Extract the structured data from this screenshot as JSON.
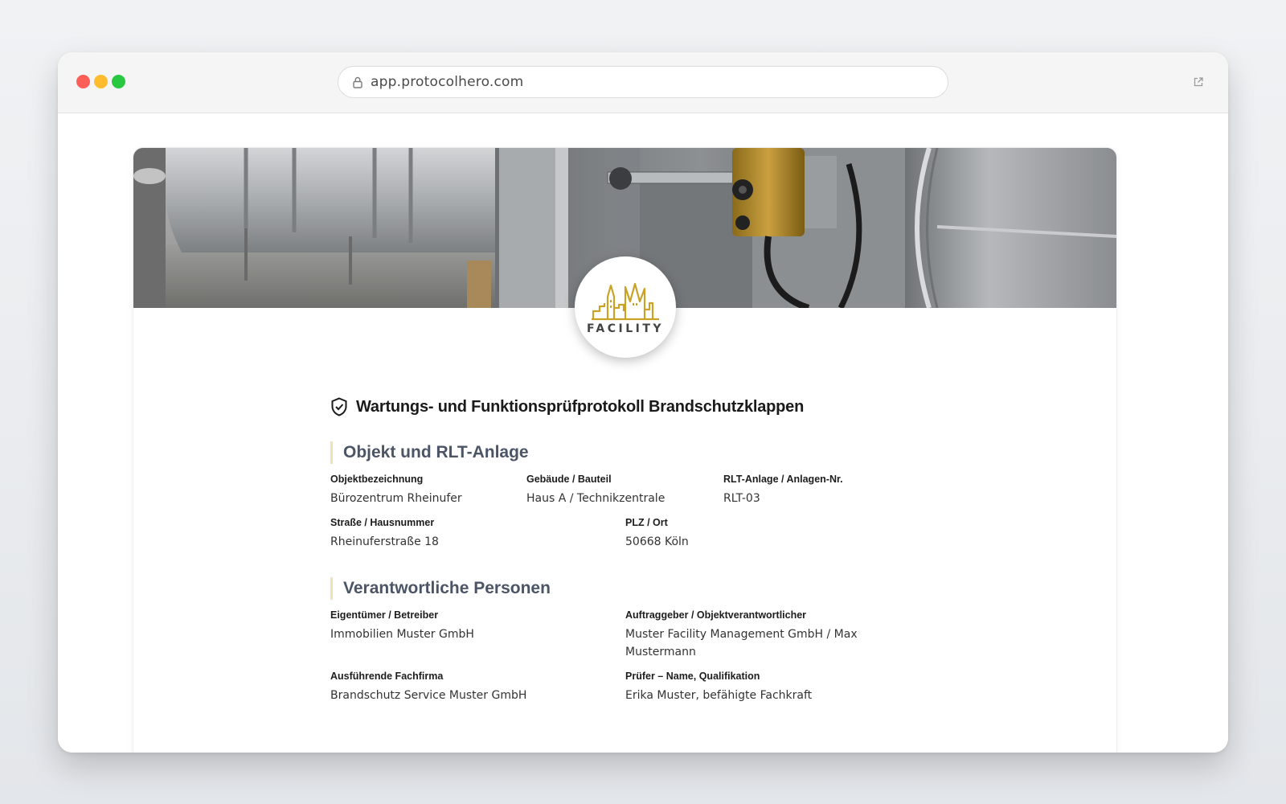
{
  "browser": {
    "url": "app.protocolhero.com",
    "icons": {
      "lock": "lock-icon",
      "external": "external-link-icon"
    }
  },
  "logo": {
    "text": "FACILITY",
    "accent": "#c9a227"
  },
  "document": {
    "title": "Wartungs- und Funktionsprüfprotokoll Brandschutzklappen",
    "title_icon": "shield-check-icon",
    "sections": [
      {
        "heading": "Objekt und RLT-Anlage",
        "fields": [
          {
            "label": "Objektbezeichnung",
            "value": "Bürozentrum Rheinufer"
          },
          {
            "label": "Gebäude / Bauteil",
            "value": "Haus A / Technikzentrale"
          },
          {
            "label": "RLT-Anlage / Anlagen-Nr.",
            "value": "RLT-03"
          },
          {
            "label": "Straße / Hausnummer",
            "value": "Rheinuferstraße 18"
          },
          {
            "label": "PLZ / Ort",
            "value": "50668 Köln"
          }
        ]
      },
      {
        "heading": "Verantwortliche Personen",
        "fields": [
          {
            "label": "Eigentümer / Betreiber",
            "value": "Immobilien Muster GmbH"
          },
          {
            "label": "Auftraggeber / Objektverantwortlicher",
            "value": "Muster Facility Management GmbH / Max Mustermann"
          },
          {
            "label": "Ausführende Fachfirma",
            "value": "Brandschutz Service Muster GmbH"
          },
          {
            "label": "Prüfer – Name, Qualifikation",
            "value": "Erika Muster, befähigte Fachkraft"
          }
        ]
      }
    ]
  },
  "colors": {
    "section_accent": "#f1e2b3",
    "section_heading": "#4c5566",
    "traffic_red": "#fe5f57",
    "traffic_yellow": "#febc2e",
    "traffic_green": "#28c840"
  }
}
